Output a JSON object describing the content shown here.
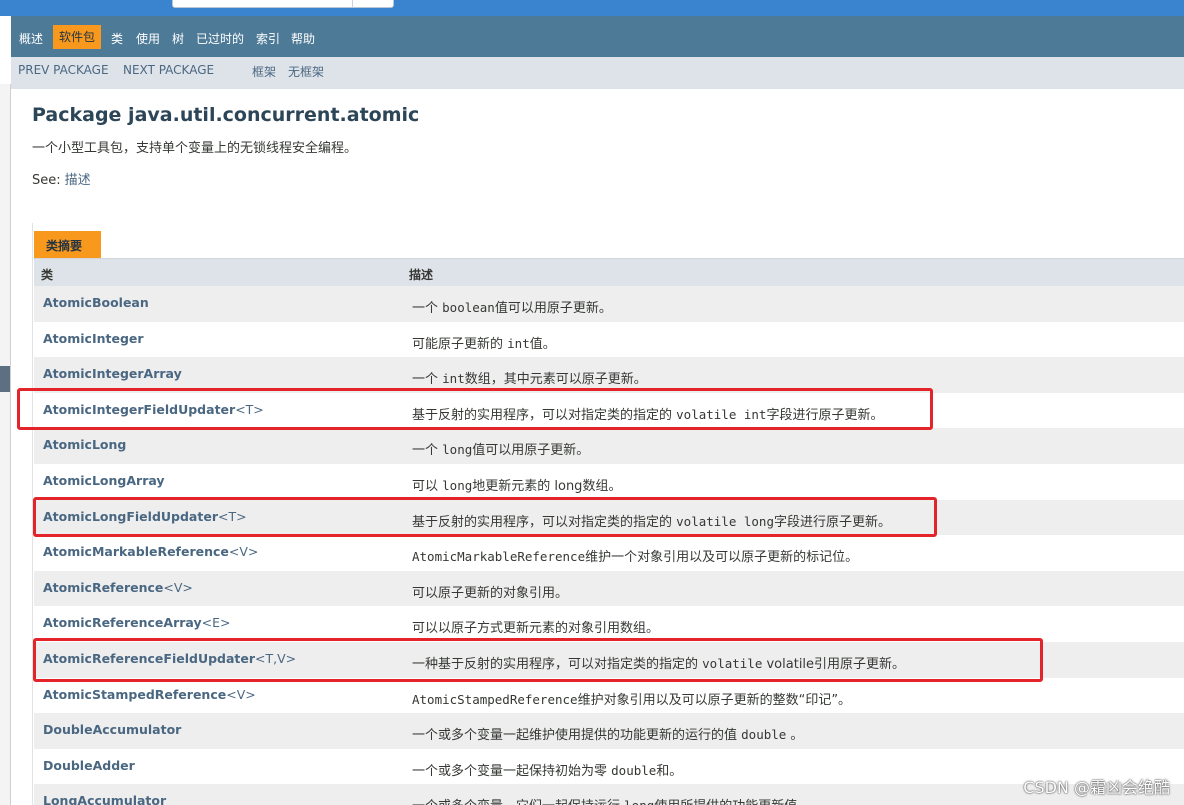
{
  "nav": {
    "items": [
      "概述",
      "软件包",
      "类",
      "使用",
      "树",
      "已过时的",
      "索引",
      "帮助"
    ],
    "active": "软件包"
  },
  "subnav": {
    "prev": "PREV PACKAGE",
    "next": "NEXT PACKAGE",
    "frames": "框架",
    "noframes": "无框架"
  },
  "page": {
    "title": "Package java.util.concurrent.atomic",
    "description": "一个小型工具包，支持单个变量上的无锁线程安全编程。",
    "see_label": "See:",
    "see_link": "描述"
  },
  "summary": {
    "caption": "类摘要",
    "col_class": "类",
    "col_desc": "描述",
    "rows": [
      {
        "name": "AtomicBoolean",
        "tparam": "",
        "d1": "一个 ",
        "code": "boolean",
        "d2": "值可以用原子更新。"
      },
      {
        "name": "AtomicInteger",
        "tparam": "",
        "d1": "可能原子更新的 ",
        "code": "int",
        "d2": "值。"
      },
      {
        "name": "AtomicIntegerArray",
        "tparam": "",
        "d1": "一个 ",
        "code": "int",
        "d2": "数组，其中元素可以原子更新。"
      },
      {
        "name": "AtomicIntegerFieldUpdater",
        "tparam": "<T>",
        "d1": "基于反射的实用程序，可以对指定类的指定的 ",
        "code": "volatile int",
        "d2": "字段进行原子更新。"
      },
      {
        "name": "AtomicLong",
        "tparam": "",
        "d1": "一个 ",
        "code": "long",
        "d2": "值可以用原子更新。"
      },
      {
        "name": "AtomicLongArray",
        "tparam": "",
        "d1": "可以 ",
        "code": "long",
        "d2": "地更新元素的 long数组。"
      },
      {
        "name": "AtomicLongFieldUpdater",
        "tparam": "<T>",
        "d1": "基于反射的实用程序，可以对指定类的指定的 ",
        "code": "volatile long",
        "d2": "字段进行原子更新。"
      },
      {
        "name": "AtomicMarkableReference",
        "tparam": "<V>",
        "d1": "",
        "code": "AtomicMarkableReference",
        "d2": "维护一个对象引用以及可以原子更新的标记位。"
      },
      {
        "name": "AtomicReference",
        "tparam": "<V>",
        "d1": "可以原子更新的对象引用。",
        "code": "",
        "d2": ""
      },
      {
        "name": "AtomicReferenceArray",
        "tparam": "<E>",
        "d1": "可以以原子方式更新元素的对象引用数组。",
        "code": "",
        "d2": ""
      },
      {
        "name": "AtomicReferenceFieldUpdater",
        "tparam": "<T,V>",
        "d1": "一种基于反射的实用程序，可以对指定类的指定的 ",
        "code": "volatile",
        "d2": " volatile引用原子更新。"
      },
      {
        "name": "AtomicStampedReference",
        "tparam": "<V>",
        "d1": "",
        "code": "AtomicStampedReference",
        "d2": "维护对象引用以及可以原子更新的整数“印记”。"
      },
      {
        "name": "DoubleAccumulator",
        "tparam": "",
        "d1": "一个或多个变量一起维护使用提供的功能更新的运行的值 ",
        "code": "double",
        "d2": " 。"
      },
      {
        "name": "DoubleAdder",
        "tparam": "",
        "d1": "一个或多个变量一起保持初始为零 ",
        "code": "double",
        "d2": "和。"
      },
      {
        "name": "LongAccumulator",
        "tparam": "",
        "d1": "一个或多个变量，它们一起保持运行 ",
        "code": "long",
        "d2": "使用所提供的功能更新值。"
      }
    ]
  },
  "watermark": "CSDN @霜凶会绝酷"
}
